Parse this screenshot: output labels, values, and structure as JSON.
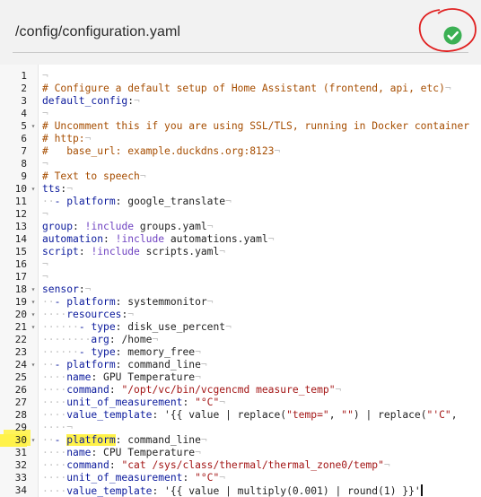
{
  "header": {
    "file_path": "/config/configuration.yaml",
    "status_icon": "check-circle-icon",
    "status_color": "#3bb054",
    "annotation_color": "#e02020",
    "accent_color": "#e8574a"
  },
  "editor": {
    "lines": [
      {
        "n": "1",
        "text": "¬",
        "fold": false
      },
      {
        "n": "2",
        "text": "# Configure a default setup of Home Assistant (frontend, api, etc)¬",
        "fold": false
      },
      {
        "n": "3",
        "text": "default_config:¬",
        "fold": false
      },
      {
        "n": "4",
        "text": "¬",
        "fold": false
      },
      {
        "n": "5",
        "text": "# Uncomment this if you are using SSL/TLS, running in Docker container",
        "fold": true
      },
      {
        "n": "6",
        "text": "# http:¬",
        "fold": false
      },
      {
        "n": "7",
        "text": "#   base_url: example.duckdns.org:8123¬",
        "fold": false
      },
      {
        "n": "8",
        "text": "¬",
        "fold": false
      },
      {
        "n": "9",
        "text": "# Text to speech¬",
        "fold": false
      },
      {
        "n": "10",
        "text": "tts:¬",
        "fold": true
      },
      {
        "n": "11",
        "text": "  - platform: google_translate¬",
        "fold": false
      },
      {
        "n": "12",
        "text": "¬",
        "fold": false
      },
      {
        "n": "13",
        "text": "group: !include groups.yaml¬",
        "fold": false
      },
      {
        "n": "14",
        "text": "automation: !include automations.yaml¬",
        "fold": false
      },
      {
        "n": "15",
        "text": "script: !include scripts.yaml¬",
        "fold": false
      },
      {
        "n": "16",
        "text": "¬",
        "fold": false
      },
      {
        "n": "17",
        "text": "¬",
        "fold": false
      },
      {
        "n": "18",
        "text": "sensor:¬",
        "fold": true
      },
      {
        "n": "19",
        "text": "  - platform: systemmonitor¬",
        "fold": true
      },
      {
        "n": "20",
        "text": "    resources:¬",
        "fold": true
      },
      {
        "n": "21",
        "text": "      - type: disk_use_percent¬",
        "fold": true
      },
      {
        "n": "22",
        "text": "        arg: /home¬",
        "fold": false
      },
      {
        "n": "23",
        "text": "      - type: memory_free¬",
        "fold": false
      },
      {
        "n": "24",
        "text": "  - platform: command_line¬",
        "fold": true
      },
      {
        "n": "25",
        "text": "    name: GPU Temperature¬",
        "fold": false
      },
      {
        "n": "26",
        "text": "    command: \"/opt/vc/bin/vcgencmd measure_temp\"¬",
        "fold": false
      },
      {
        "n": "27",
        "text": "    unit_of_measurement: \"°C\"¬",
        "fold": false
      },
      {
        "n": "28",
        "text": "    value_template: '{{ value | replace(\"temp=\", \"\") | replace(\"'C\",",
        "fold": false
      },
      {
        "n": "29",
        "text": "    ¬",
        "fold": false
      },
      {
        "n": "30",
        "text": "  - platform: command_line¬",
        "fold": true
      },
      {
        "n": "31",
        "text": "    name: CPU Temperature¬",
        "fold": false
      },
      {
        "n": "32",
        "text": "    command: \"cat /sys/class/thermal/thermal_zone0/temp\"¬",
        "fold": false
      },
      {
        "n": "33",
        "text": "    unit_of_measurement: \"°C\"¬",
        "fold": false
      },
      {
        "n": "34",
        "text": "    value_template: '{{ value | multiply(0.001) | round(1) }}'",
        "fold": false
      }
    ]
  }
}
